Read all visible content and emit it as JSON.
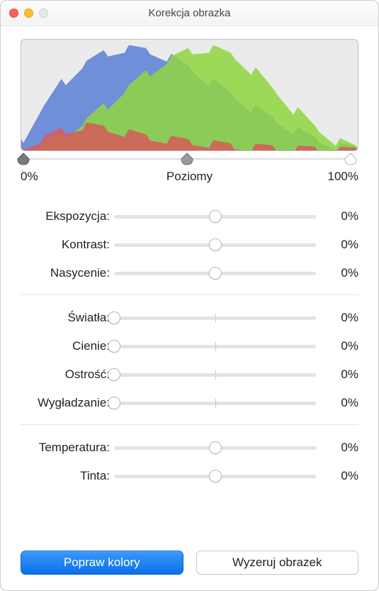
{
  "window": {
    "title": "Korekcja obrazka"
  },
  "levels": {
    "leftLabel": "0%",
    "midLabel": "Poziomy",
    "rightLabel": "100%",
    "black": 0,
    "mid": 50,
    "white": 100
  },
  "groups": [
    {
      "rows": [
        {
          "label": "Ekspozycja:",
          "value": "0%",
          "pos": 50,
          "tick": null
        },
        {
          "label": "Kontrast:",
          "value": "0%",
          "pos": 50,
          "tick": null
        },
        {
          "label": "Nasycenie:",
          "value": "0%",
          "pos": 50,
          "tick": null
        }
      ]
    },
    {
      "rows": [
        {
          "label": "Światła:",
          "value": "0%",
          "pos": 0,
          "tick": 50
        },
        {
          "label": "Cienie:",
          "value": "0%",
          "pos": 0,
          "tick": 50
        },
        {
          "label": "Ostrość:",
          "value": "0%",
          "pos": 0,
          "tick": 50
        },
        {
          "label": "Wygładzanie:",
          "value": "0%",
          "pos": 0,
          "tick": 50
        }
      ]
    },
    {
      "rows": [
        {
          "label": "Temperatura:",
          "value": "0%",
          "pos": 50,
          "tick": null
        },
        {
          "label": "Tinta:",
          "value": "0%",
          "pos": 50,
          "tick": null
        }
      ]
    }
  ],
  "buttons": {
    "enhance": "Popraw kolory",
    "reset": "Wyzeruj obrazek"
  },
  "chart_data": {
    "type": "area",
    "title": "",
    "xlabel": "",
    "ylabel": "",
    "x_range": [
      0,
      255
    ],
    "y_range": [
      0,
      100
    ],
    "note": "RGB histogram of image luminance; values are approximate envelope heights read from the graphic",
    "series": [
      {
        "name": "blue",
        "color": "#5b7fd6",
        "x": [
          0,
          16,
          32,
          48,
          64,
          80,
          96,
          112,
          128,
          144,
          160,
          176,
          192,
          208,
          224,
          240,
          255
        ],
        "values": [
          10,
          38,
          62,
          78,
          88,
          92,
          90,
          84,
          74,
          62,
          50,
          38,
          28,
          18,
          10,
          4,
          1
        ]
      },
      {
        "name": "green",
        "color": "#8fd63f",
        "x": [
          0,
          16,
          32,
          48,
          64,
          80,
          96,
          112,
          128,
          144,
          160,
          176,
          192,
          208,
          224,
          240,
          255
        ],
        "values": [
          2,
          6,
          14,
          26,
          40,
          56,
          70,
          82,
          90,
          92,
          86,
          72,
          54,
          36,
          20,
          8,
          2
        ]
      },
      {
        "name": "red",
        "color": "#d65b5b",
        "x": [
          0,
          16,
          32,
          48,
          64,
          80,
          96,
          112,
          128,
          144,
          160,
          176,
          192,
          208,
          224,
          240,
          255
        ],
        "values": [
          4,
          10,
          18,
          22,
          20,
          16,
          12,
          10,
          8,
          6,
          4,
          3,
          2,
          1,
          1,
          0,
          0
        ]
      }
    ]
  }
}
